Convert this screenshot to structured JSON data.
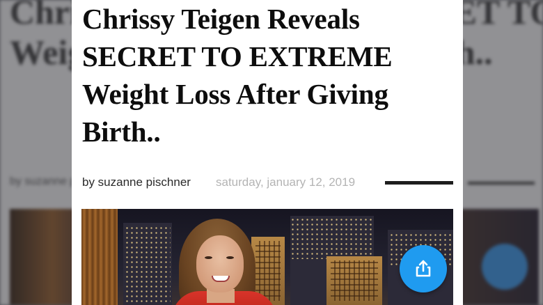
{
  "article": {
    "headline": "Chrissy Teigen Reveals SECRET TO EXTREME Weight Loss After Giving Birth..",
    "author": "by suzanne pischner",
    "date": "saturday, january 12, 2019"
  },
  "background": {
    "headline": "Chrissy Teigen Reveals SECRET TO EXTREME Weight Loss After Giving Birth..",
    "byline": "by suzanne pischner"
  },
  "colors": {
    "share_button": "#1f9bf0",
    "date_text": "#b4b4b4",
    "headline_text": "#0d0d0d"
  },
  "icons": {
    "share": "share-icon"
  }
}
